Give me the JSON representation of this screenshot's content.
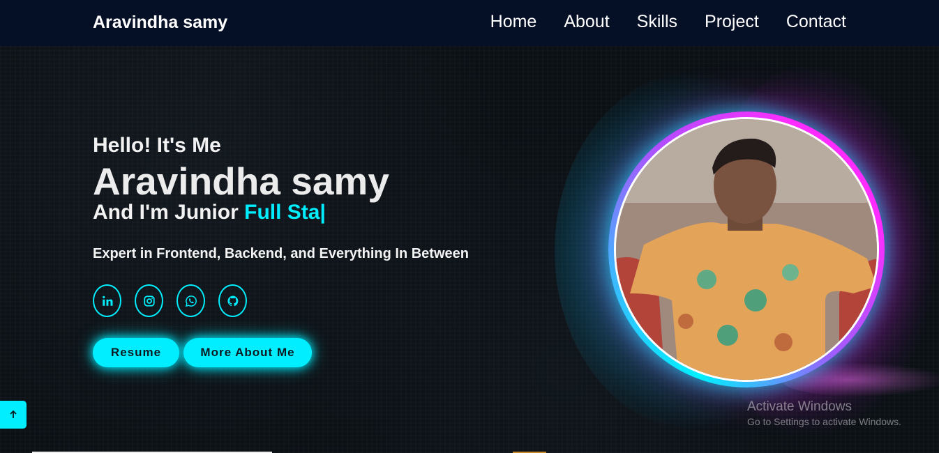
{
  "header": {
    "logo": "Aravindha samy",
    "nav": [
      "Home",
      "About",
      "Skills",
      "Project",
      "Contact"
    ]
  },
  "hero": {
    "greeting": "Hello! It's Me",
    "name": "Aravindha samy",
    "role_prefix": "And I'm Junior ",
    "role_typed": "Full Sta|",
    "tagline": "Expert in Frontend, Backend, and Everything In Between",
    "socials": [
      "linkedin-icon",
      "instagram-icon",
      "whatsapp-icon",
      "github-icon"
    ],
    "buttons": {
      "resume": "Resume",
      "more": "More About Me"
    }
  },
  "colors": {
    "accent": "#00eeff",
    "header_bg": "#050f26",
    "page_bg": "#0c1116",
    "magenta_glow": "#ff2cff"
  },
  "watermark": {
    "title": "Activate Windows",
    "subtitle": "Go to Settings to activate Windows."
  }
}
